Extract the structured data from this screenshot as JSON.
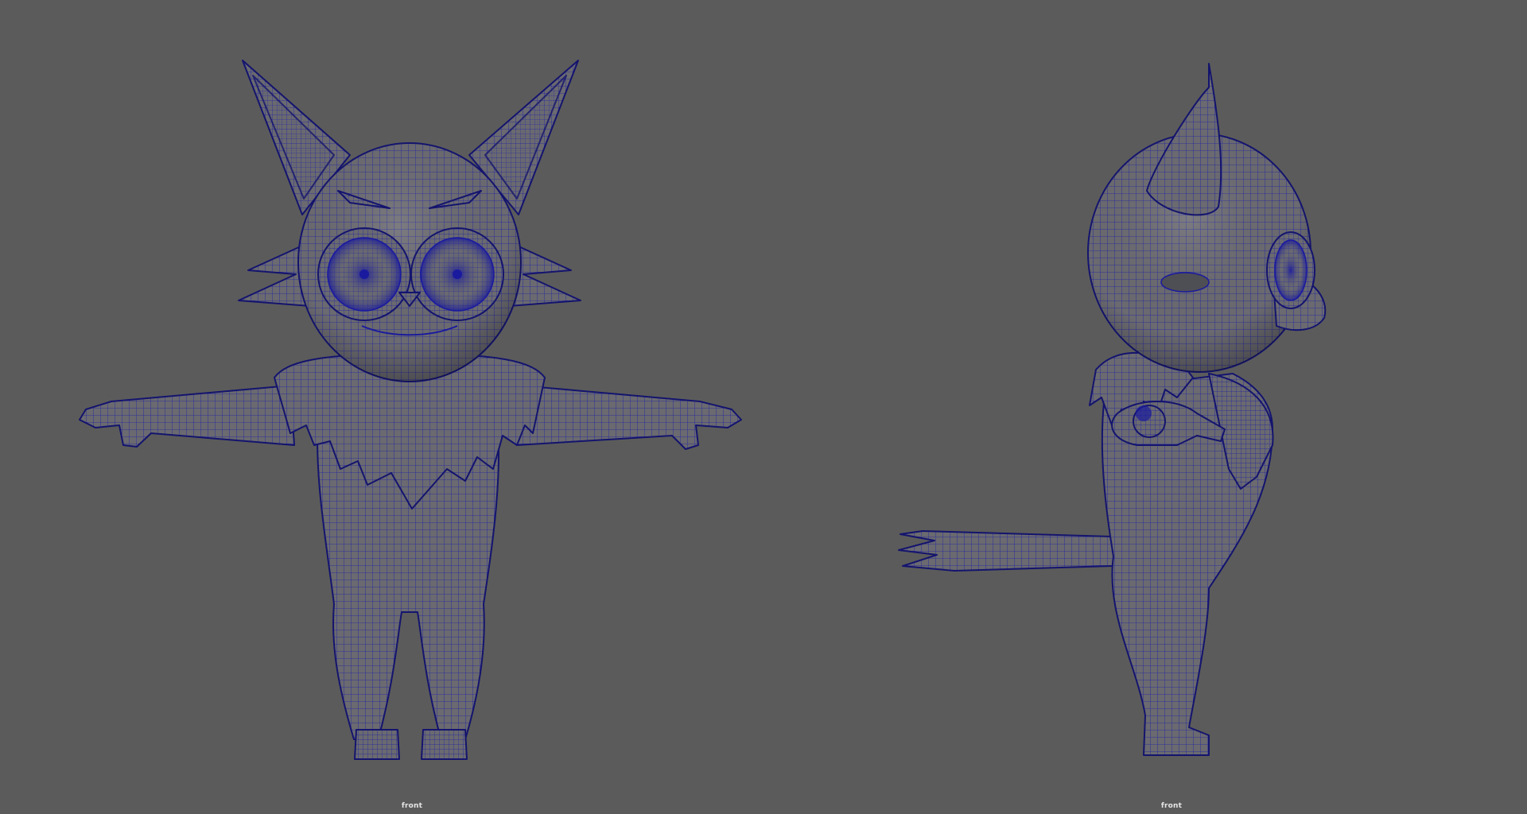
{
  "app": {
    "background_color": "#5b5b5b"
  },
  "viewports": [
    {
      "camera_label": "front",
      "view": "front-view",
      "model": "cat-character-wireframe"
    },
    {
      "camera_label": "front",
      "view": "side-view",
      "model": "cat-character-wireframe"
    }
  ],
  "colors": {
    "mesh_fill": "#6b6b70",
    "mesh_shade": "#55555a",
    "wire": "#1a1a9e",
    "outline": "#14146e"
  }
}
